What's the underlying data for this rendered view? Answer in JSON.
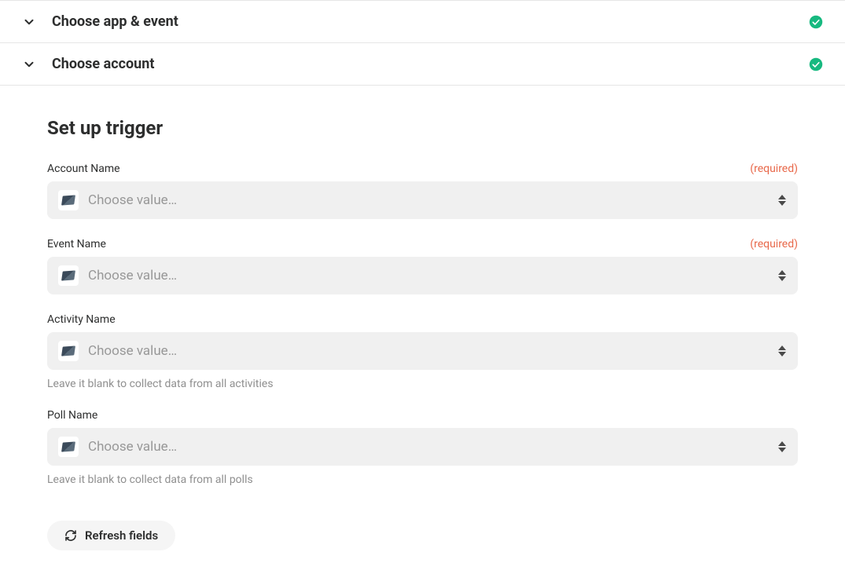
{
  "steps": {
    "choose_app_event": {
      "title": "Choose app & event"
    },
    "choose_account": {
      "title": "Choose account"
    }
  },
  "section": {
    "title": "Set up trigger"
  },
  "required_tag": "(required)",
  "fields": {
    "account_name": {
      "label": "Account Name",
      "placeholder": "Choose value…"
    },
    "event_name": {
      "label": "Event Name",
      "placeholder": "Choose value…"
    },
    "activity_name": {
      "label": "Activity Name",
      "placeholder": "Choose value…",
      "help": "Leave it blank to collect data from all activities"
    },
    "poll_name": {
      "label": "Poll Name",
      "placeholder": "Choose value…",
      "help": "Leave it blank to collect data from all polls"
    }
  },
  "buttons": {
    "refresh": "Refresh fields"
  },
  "colors": {
    "required": "#e8684a",
    "success": "#17b980",
    "placeholder": "#989898",
    "dropdown_bg": "#f0f0f0"
  }
}
